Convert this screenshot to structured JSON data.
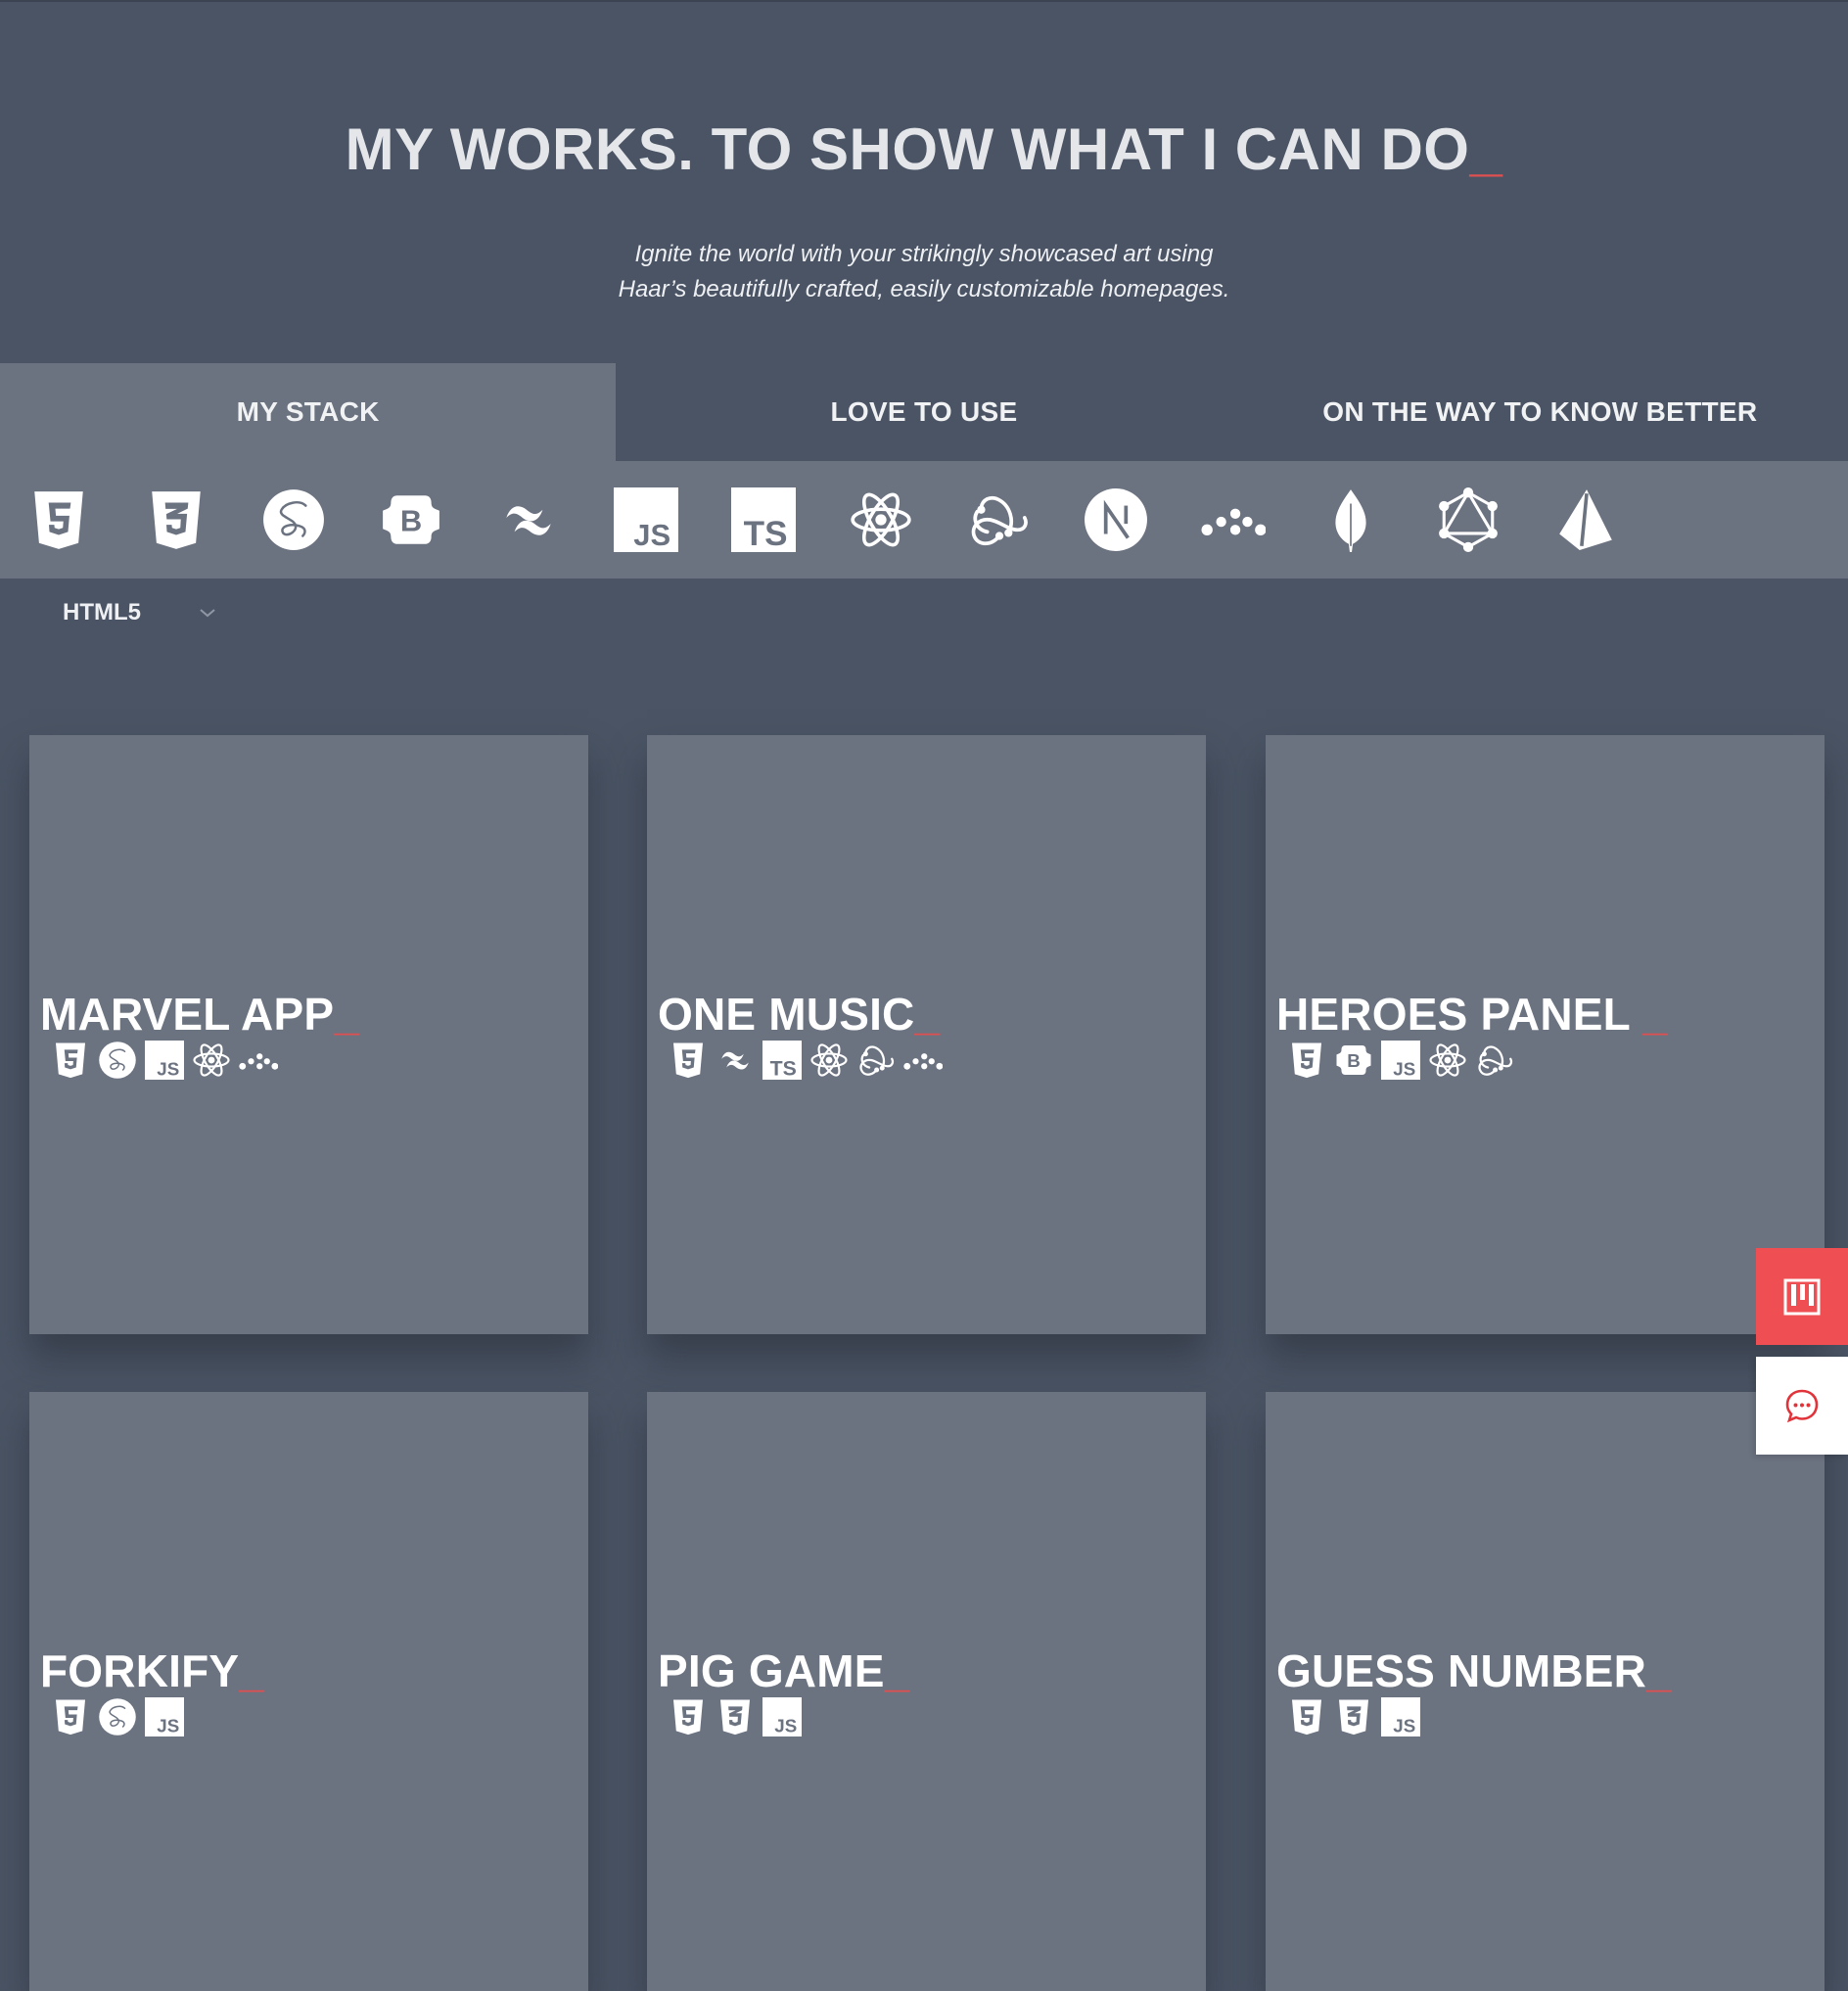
{
  "header": {
    "title": "MY WORKS. TO SHOW WHAT I CAN DO",
    "cursor": "_",
    "subtitle_line1": "Ignite the world with your strikingly showcased art using",
    "subtitle_line2": "Haar’s beautifully crafted, easily customizable homepages."
  },
  "tabs": [
    {
      "label": "MY STACK",
      "active": true
    },
    {
      "label": "LOVE TO USE",
      "active": false
    },
    {
      "label": "ON THE WAY TO KNOW BETTER",
      "active": false
    }
  ],
  "stack_icons": [
    "html5-icon",
    "css3-icon",
    "sass-icon",
    "bootstrap-icon",
    "tailwind-icon",
    "javascript-icon",
    "typescript-icon",
    "react-icon",
    "redux-icon",
    "nextjs-icon",
    "vite-dots-icon",
    "mongodb-icon",
    "graphql-icon",
    "prisma-icon"
  ],
  "filter": {
    "selected": "HTML5"
  },
  "projects": [
    {
      "title": "MARVEL APP",
      "cursor": "_",
      "icons": [
        "html5-icon",
        "sass-icon",
        "javascript-icon",
        "react-icon",
        "vite-dots-icon"
      ]
    },
    {
      "title": "ONE MUSIC",
      "cursor": "_",
      "icons": [
        "html5-icon",
        "tailwind-icon",
        "typescript-icon",
        "react-icon",
        "redux-icon",
        "vite-dots-icon"
      ]
    },
    {
      "title": "HEROES PANEL ",
      "cursor": "_",
      "icons": [
        "html5-icon",
        "bootstrap-icon",
        "javascript-icon",
        "react-icon",
        "redux-icon"
      ]
    },
    {
      "title": "FORKIFY",
      "cursor": "_",
      "icons": [
        "html5-icon",
        "sass-icon",
        "javascript-icon"
      ]
    },
    {
      "title": "PIG GAME",
      "cursor": "_",
      "icons": [
        "html5-icon",
        "css3-icon",
        "javascript-icon"
      ]
    },
    {
      "title": "GUESS NUMBER",
      "cursor": "_",
      "icons": [
        "html5-icon",
        "css3-icon",
        "javascript-icon"
      ]
    }
  ],
  "side_buttons": [
    {
      "icon": "piano-keys-icon",
      "color": "#ef4f52"
    },
    {
      "icon": "chat-bubble-icon",
      "color": "#ffffff"
    }
  ],
  "colors": {
    "background": "#4a5464",
    "panel": "#6b7280",
    "accent": "#e05050"
  }
}
